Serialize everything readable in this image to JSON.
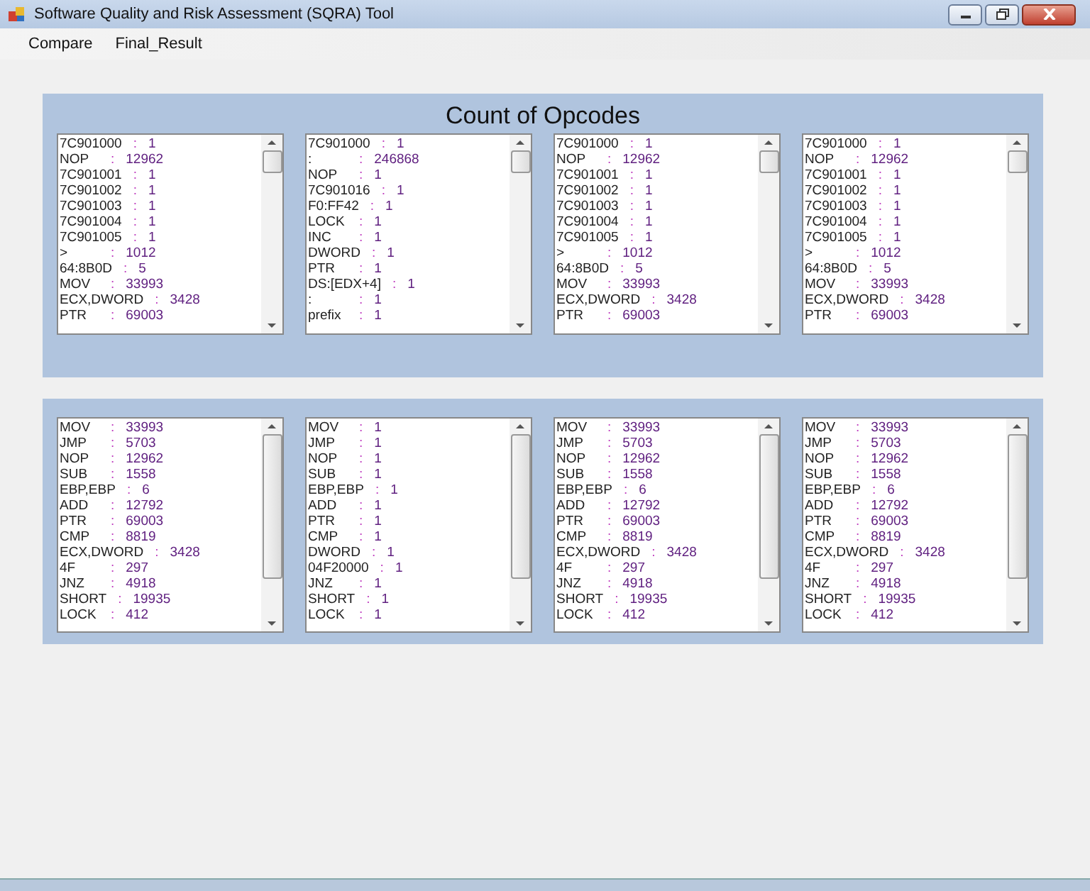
{
  "window": {
    "title": "Software Quality and Risk Assessment (SQRA) Tool"
  },
  "menu": [
    "Compare",
    "Final_Result"
  ],
  "sections": [
    {
      "title": "Count of Opcodes",
      "lists": [
        [
          {
            "name": "7C901000",
            "sep": ":",
            "value": "1"
          },
          {
            "name": "NOP",
            "sep": ":",
            "value": "12962"
          },
          {
            "name": "7C901001",
            "sep": ":",
            "value": "1"
          },
          {
            "name": "7C901002",
            "sep": ":",
            "value": "1"
          },
          {
            "name": "7C901003",
            "sep": ":",
            "value": "1"
          },
          {
            "name": "7C901004",
            "sep": ":",
            "value": "1"
          },
          {
            "name": "7C901005",
            "sep": ":",
            "value": "1"
          },
          {
            "name": ">",
            "sep": ":",
            "value": "1012"
          },
          {
            "name": "64:8B0D",
            "sep": ":",
            "value": "5"
          },
          {
            "name": "MOV",
            "sep": ":",
            "value": "33993"
          },
          {
            "name": "ECX,DWORD",
            "sep": ":",
            "value": "3428"
          },
          {
            "name": "PTR",
            "sep": ":",
            "value": "69003"
          }
        ],
        [
          {
            "name": "7C901000",
            "sep": ":",
            "value": "1"
          },
          {
            "name": ":",
            "sep": ":",
            "value": "246868"
          },
          {
            "name": "NOP",
            "sep": ":",
            "value": "1"
          },
          {
            "name": "7C901016",
            "sep": ":",
            "value": "1"
          },
          {
            "name": "F0:FF42",
            "sep": ":",
            "value": "1"
          },
          {
            "name": "LOCK",
            "sep": ":",
            "value": "1"
          },
          {
            "name": "INC",
            "sep": ":",
            "value": "1"
          },
          {
            "name": "DWORD",
            "sep": ":",
            "value": "1"
          },
          {
            "name": "PTR",
            "sep": ":",
            "value": "1"
          },
          {
            "name": "DS:[EDX+4]",
            "sep": ":",
            "value": "1"
          },
          {
            "name": ":",
            "sep": ":",
            "value": "1"
          },
          {
            "name": "prefix",
            "sep": ":",
            "value": "1"
          }
        ],
        [
          {
            "name": "7C901000",
            "sep": ":",
            "value": "1"
          },
          {
            "name": "NOP",
            "sep": ":",
            "value": "12962"
          },
          {
            "name": "7C901001",
            "sep": ":",
            "value": "1"
          },
          {
            "name": "7C901002",
            "sep": ":",
            "value": "1"
          },
          {
            "name": "7C901003",
            "sep": ":",
            "value": "1"
          },
          {
            "name": "7C901004",
            "sep": ":",
            "value": "1"
          },
          {
            "name": "7C901005",
            "sep": ":",
            "value": "1"
          },
          {
            "name": ">",
            "sep": ":",
            "value": "1012"
          },
          {
            "name": "64:8B0D",
            "sep": ":",
            "value": "5"
          },
          {
            "name": "MOV",
            "sep": ":",
            "value": "33993"
          },
          {
            "name": "ECX,DWORD",
            "sep": ":",
            "value": "3428"
          },
          {
            "name": "PTR",
            "sep": ":",
            "value": "69003"
          }
        ],
        [
          {
            "name": "7C901000",
            "sep": ":",
            "value": "1"
          },
          {
            "name": "NOP",
            "sep": ":",
            "value": "12962"
          },
          {
            "name": "7C901001",
            "sep": ":",
            "value": "1"
          },
          {
            "name": "7C901002",
            "sep": ":",
            "value": "1"
          },
          {
            "name": "7C901003",
            "sep": ":",
            "value": "1"
          },
          {
            "name": "7C901004",
            "sep": ":",
            "value": "1"
          },
          {
            "name": "7C901005",
            "sep": ":",
            "value": "1"
          },
          {
            "name": ">",
            "sep": ":",
            "value": "1012"
          },
          {
            "name": "64:8B0D",
            "sep": ":",
            "value": "5"
          },
          {
            "name": "MOV",
            "sep": ":",
            "value": "33993"
          },
          {
            "name": "ECX,DWORD",
            "sep": ":",
            "value": "3428"
          },
          {
            "name": "PTR",
            "sep": ":",
            "value": "69003"
          }
        ]
      ]
    },
    {
      "lists": [
        [
          {
            "name": "MOV",
            "sep": ":",
            "value": "33993"
          },
          {
            "name": "JMP",
            "sep": ":",
            "value": "5703"
          },
          {
            "name": "NOP",
            "sep": ":",
            "value": "12962"
          },
          {
            "name": "SUB",
            "sep": ":",
            "value": "1558"
          },
          {
            "name": "EBP,EBP",
            "sep": ":",
            "value": "6"
          },
          {
            "name": "ADD",
            "sep": ":",
            "value": "12792"
          },
          {
            "name": "PTR",
            "sep": ":",
            "value": "69003"
          },
          {
            "name": "CMP",
            "sep": ":",
            "value": "8819"
          },
          {
            "name": "ECX,DWORD",
            "sep": ":",
            "value": "3428"
          },
          {
            "name": "4F",
            "sep": ":",
            "value": "297"
          },
          {
            "name": "JNZ",
            "sep": ":",
            "value": "4918"
          },
          {
            "name": "SHORT",
            "sep": ":",
            "value": "19935"
          },
          {
            "name": "LOCK",
            "sep": ":",
            "value": "412"
          }
        ],
        [
          {
            "name": "MOV",
            "sep": ":",
            "value": "1"
          },
          {
            "name": "JMP",
            "sep": ":",
            "value": "1"
          },
          {
            "name": "NOP",
            "sep": ":",
            "value": "1"
          },
          {
            "name": "SUB",
            "sep": ":",
            "value": "1"
          },
          {
            "name": "EBP,EBP",
            "sep": ":",
            "value": "1"
          },
          {
            "name": "ADD",
            "sep": ":",
            "value": "1"
          },
          {
            "name": "PTR",
            "sep": ":",
            "value": "1"
          },
          {
            "name": "CMP",
            "sep": ":",
            "value": "1"
          },
          {
            "name": "DWORD",
            "sep": ":",
            "value": "1"
          },
          {
            "name": "04F20000",
            "sep": ":",
            "value": "1"
          },
          {
            "name": "JNZ",
            "sep": ":",
            "value": "1"
          },
          {
            "name": "SHORT",
            "sep": ":",
            "value": "1"
          },
          {
            "name": "LOCK",
            "sep": ":",
            "value": "1"
          }
        ],
        [
          {
            "name": "MOV",
            "sep": ":",
            "value": "33993"
          },
          {
            "name": "JMP",
            "sep": ":",
            "value": "5703"
          },
          {
            "name": "NOP",
            "sep": ":",
            "value": "12962"
          },
          {
            "name": "SUB",
            "sep": ":",
            "value": "1558"
          },
          {
            "name": "EBP,EBP",
            "sep": ":",
            "value": "6"
          },
          {
            "name": "ADD",
            "sep": ":",
            "value": "12792"
          },
          {
            "name": "PTR",
            "sep": ":",
            "value": "69003"
          },
          {
            "name": "CMP",
            "sep": ":",
            "value": "8819"
          },
          {
            "name": "ECX,DWORD",
            "sep": ":",
            "value": "3428"
          },
          {
            "name": "4F",
            "sep": ":",
            "value": "297"
          },
          {
            "name": "JNZ",
            "sep": ":",
            "value": "4918"
          },
          {
            "name": "SHORT",
            "sep": ":",
            "value": "19935"
          },
          {
            "name": "LOCK",
            "sep": ":",
            "value": "412"
          }
        ],
        [
          {
            "name": "MOV",
            "sep": ":",
            "value": "33993"
          },
          {
            "name": "JMP",
            "sep": ":",
            "value": "5703"
          },
          {
            "name": "NOP",
            "sep": ":",
            "value": "12962"
          },
          {
            "name": "SUB",
            "sep": ":",
            "value": "1558"
          },
          {
            "name": "EBP,EBP",
            "sep": ":",
            "value": "6"
          },
          {
            "name": "ADD",
            "sep": ":",
            "value": "12792"
          },
          {
            "name": "PTR",
            "sep": ":",
            "value": "69003"
          },
          {
            "name": "CMP",
            "sep": ":",
            "value": "8819"
          },
          {
            "name": "ECX,DWORD",
            "sep": ":",
            "value": "3428"
          },
          {
            "name": "4F",
            "sep": ":",
            "value": "297"
          },
          {
            "name": "JNZ",
            "sep": ":",
            "value": "4918"
          },
          {
            "name": "SHORT",
            "sep": ":",
            "value": "19935"
          },
          {
            "name": "LOCK",
            "sep": ":",
            "value": "412"
          }
        ]
      ]
    }
  ]
}
